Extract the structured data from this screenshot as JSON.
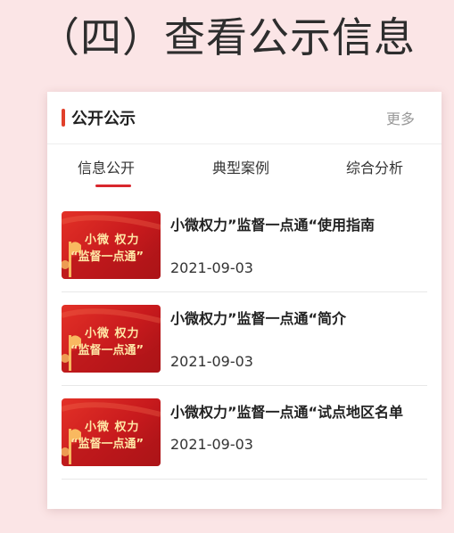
{
  "heading": "（四）查看公示信息",
  "card": {
    "title": "公开公示",
    "more": "更多",
    "accent_color": "#e1402b"
  },
  "tabs": [
    {
      "label": "信息公开",
      "active": true
    },
    {
      "label": "典型案例",
      "active": false
    },
    {
      "label": "综合分析",
      "active": false
    }
  ],
  "thumbnail": {
    "line1": "小微 权力",
    "line2": "“监督一点通”",
    "colors": [
      "#e33127",
      "#c81a1d",
      "#ffe7a6"
    ]
  },
  "items": [
    {
      "title": "小微权力”监督一点通“使用指南",
      "date": "2021-09-03"
    },
    {
      "title": "小微权力”监督一点通“简介",
      "date": "2021-09-03"
    },
    {
      "title": "小微权力”监督一点通“试点地区名单",
      "date": "2021-09-03"
    }
  ]
}
